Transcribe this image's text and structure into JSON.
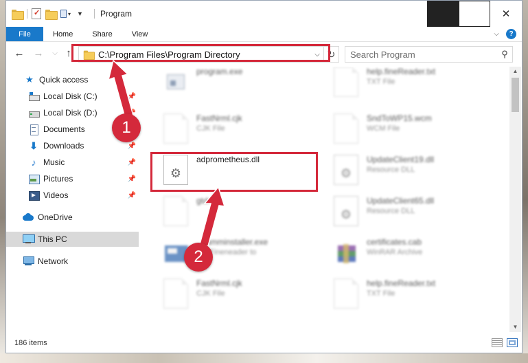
{
  "window": {
    "title": "Program"
  },
  "ribbon": {
    "tabs": [
      "File",
      "Home",
      "Share",
      "View"
    ]
  },
  "address": {
    "path": "C:\\Program Files\\Program Directory"
  },
  "search": {
    "placeholder": "Search Program"
  },
  "sidebar": {
    "items": [
      {
        "label": "Quick access",
        "icon": "star-icon"
      },
      {
        "label": "Local Disk (C:)",
        "icon": "drive-icon",
        "pinned": true
      },
      {
        "label": "Local Disk (D:)",
        "icon": "drive-icon",
        "pinned": true
      },
      {
        "label": "Documents",
        "icon": "documents-icon",
        "pinned": true
      },
      {
        "label": "Downloads",
        "icon": "download-icon",
        "pinned": true
      },
      {
        "label": "Music",
        "icon": "music-icon",
        "pinned": true
      },
      {
        "label": "Pictures",
        "icon": "pictures-icon",
        "pinned": true
      },
      {
        "label": "Videos",
        "icon": "videos-icon",
        "pinned": true
      },
      {
        "label": "OneDrive",
        "icon": "cloud-icon"
      },
      {
        "label": "This PC",
        "icon": "pc-icon",
        "selected": true
      },
      {
        "label": "Network",
        "icon": "network-icon"
      }
    ]
  },
  "files": [
    {
      "name": "program.exe",
      "type": "",
      "icon": "exe"
    },
    {
      "name": "help.fineReader.txt",
      "type": "TXT File",
      "icon": "page"
    },
    {
      "name": "FastNrml.cjk",
      "type": "CJK File",
      "icon": "page"
    },
    {
      "name": "SndToWP15.wcm",
      "type": "WCM File",
      "icon": "page"
    },
    {
      "name": "adprometheus.dll",
      "type": "",
      "icon": "gear"
    },
    {
      "name": "UpdateClient19.dll",
      "type": "Resource DLL",
      "icon": "gear"
    },
    {
      "name": "gtdr...",
      "type": "",
      "icon": "page"
    },
    {
      "name": "UpdateClient65.dll",
      "type": "Resource DLL",
      "icon": "gear"
    },
    {
      "name": "...ramminstaller.exe",
      "type": "...Y Fineneader to",
      "icon": "installer"
    },
    {
      "name": "certificates.cab",
      "type": "WinRAR Archive",
      "icon": "rar"
    },
    {
      "name": "FastNrml.cjk",
      "type": "CJK File",
      "icon": "page"
    },
    {
      "name": "help.fineReader.txt",
      "type": "TXT File",
      "icon": "page"
    }
  ],
  "status": {
    "item_count": "186 items"
  },
  "annotations": {
    "step1": "1",
    "step2": "2",
    "color": "#d4293b"
  }
}
